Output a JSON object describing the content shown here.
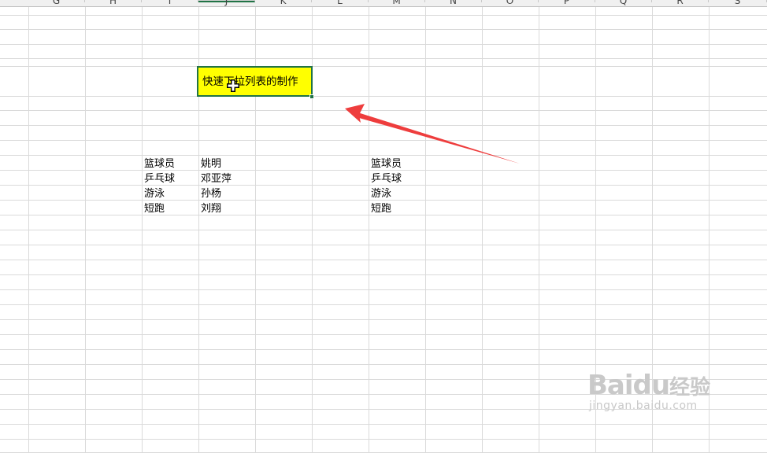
{
  "columns": [
    "G",
    "H",
    "I",
    "J",
    "K",
    "L",
    "M",
    "N",
    "O",
    "P",
    "Q",
    "R",
    "S"
  ],
  "active_column": "J",
  "selected_cell": {
    "text": "快速下拉列表的制作",
    "fill_color": "#ffff00",
    "border_color": "#217346"
  },
  "table_left": {
    "sports": [
      "篮球员",
      "乒乓球",
      "游泳",
      "短跑"
    ],
    "athletes": [
      "姚明",
      "邓亚萍",
      "孙杨",
      "刘翔"
    ]
  },
  "table_right": {
    "sports": [
      "篮球员",
      "乒乓球",
      "游泳",
      "短跑"
    ]
  },
  "annotation": {
    "color": "#ee3d3d",
    "icon": "red-arrow-annotation"
  },
  "watermark": {
    "brand": "Baidu",
    "cn": "经验",
    "url": "jingyan.baidu.com"
  },
  "colors": {
    "grid": "#dadada",
    "accent": "#217346",
    "header_bg": "#f0f0f0"
  }
}
